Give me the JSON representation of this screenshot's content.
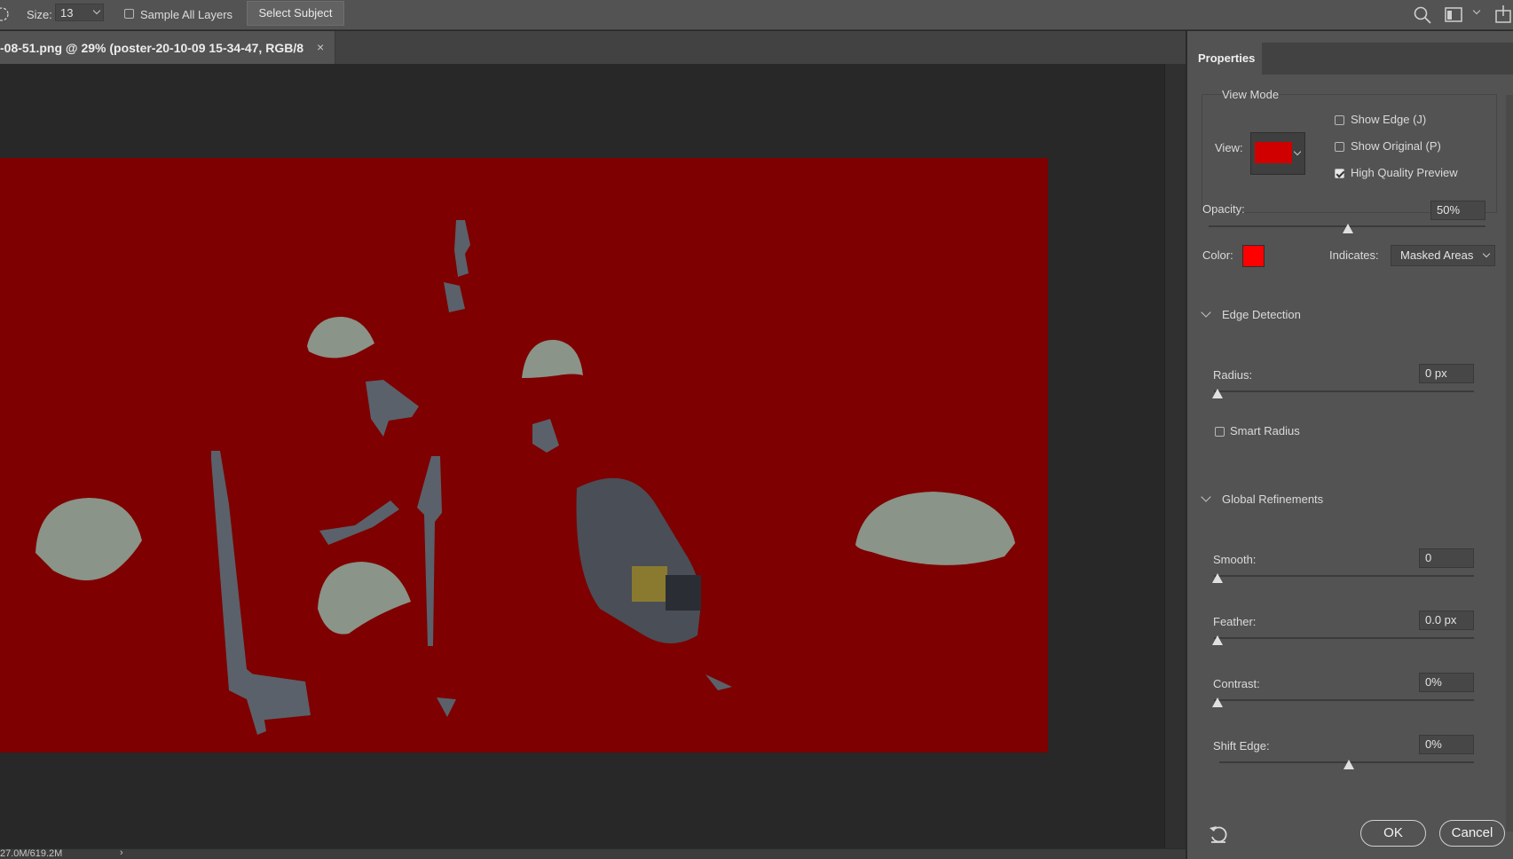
{
  "options_bar": {
    "size_label": "Size:",
    "size_value": "13",
    "sample_all_layers_label": "Sample All Layers",
    "sample_all_layers_checked": false,
    "select_subject_label": "Select Subject"
  },
  "document": {
    "tab_title": "-08-51.png @ 29% (poster-20-10-09 15-34-47, RGB/8",
    "close_glyph": "×",
    "overlay_color": "#7e0000"
  },
  "status": {
    "doc_size": "27.0M/619.2M",
    "arrow": "›"
  },
  "properties": {
    "tab_label": "Properties",
    "view_mode": {
      "title": "View Mode",
      "view_label": "View:",
      "show_edge_label": "Show Edge (J)",
      "show_edge_checked": false,
      "show_original_label": "Show Original (P)",
      "show_original_checked": false,
      "high_quality_label": "High Quality Preview",
      "high_quality_checked": true
    },
    "opacity_label": "Opacity:",
    "opacity_value": "50%",
    "opacity_level": 0.5,
    "color_label": "Color:",
    "overlay_color": "#ff0000",
    "indicates_label": "Indicates:",
    "indicates_value": "Masked Areas",
    "edge_detection": {
      "title": "Edge Detection",
      "radius_label": "Radius:",
      "radius_value": "0 px",
      "smart_radius_label": "Smart Radius",
      "smart_radius_checked": false
    },
    "global_refinements": {
      "title": "Global Refinements",
      "smooth_label": "Smooth:",
      "smooth_value": "0",
      "feather_label": "Feather:",
      "feather_value": "0.0 px",
      "contrast_label": "Contrast:",
      "contrast_value": "0%",
      "shift_edge_label": "Shift Edge:",
      "shift_edge_value": "0%"
    },
    "ok_label": "OK",
    "cancel_label": "Cancel"
  }
}
